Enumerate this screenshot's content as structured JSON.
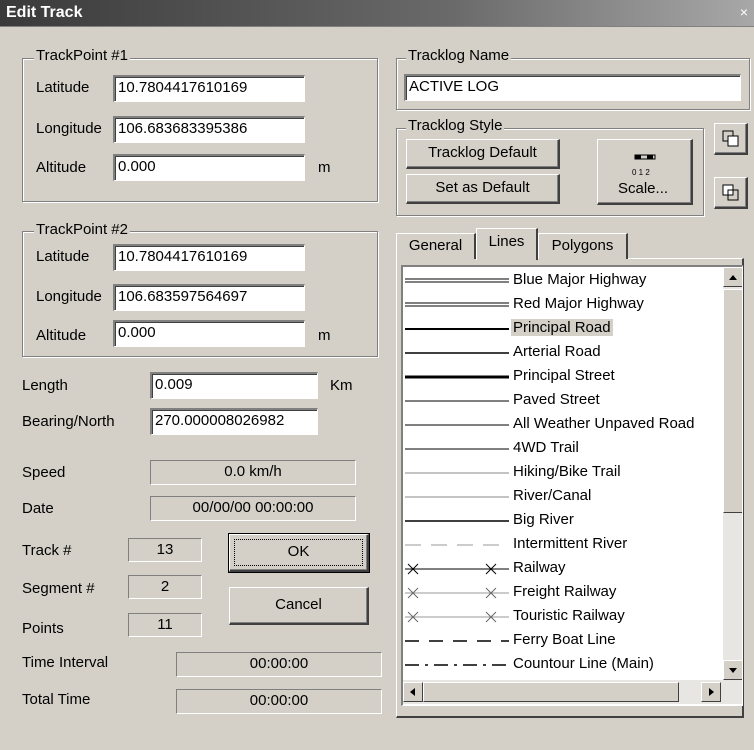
{
  "window": {
    "title": "Edit Track",
    "close_glyph": "×"
  },
  "trackpoint1": {
    "legend": "TrackPoint #1",
    "latitude_label": "Latitude",
    "latitude": "10.7804417610169",
    "longitude_label": "Longitude",
    "longitude": "106.683683395386",
    "altitude_label": "Altitude",
    "altitude": "0.000",
    "unit": "m"
  },
  "trackpoint2": {
    "legend": "TrackPoint #2",
    "latitude_label": "Latitude",
    "latitude": "10.7804417610169",
    "longitude_label": "Longitude",
    "longitude": "106.683597564697",
    "altitude_label": "Altitude",
    "altitude": "0.000",
    "unit": "m"
  },
  "stats": {
    "length_label": "Length",
    "length": "0.009",
    "length_unit": "Km",
    "bearing_label": "Bearing/North",
    "bearing": "270.000008026982",
    "speed_label": "Speed",
    "speed": "0.0 km/h",
    "date_label": "Date",
    "date": "00/00/00 00:00:00",
    "track_label": "Track #",
    "track": "13",
    "segment_label": "Segment #",
    "segment": "2",
    "points_label": "Points",
    "points": "11",
    "interval_label": "Time Interval",
    "interval": "00:00:00",
    "total_label": "Total Time",
    "total": "00:00:00"
  },
  "buttons": {
    "ok": "OK",
    "cancel": "Cancel"
  },
  "tracklog": {
    "name_legend": "Tracklog Name",
    "name": "ACTIVE LOG",
    "style_legend": "Tracklog Style",
    "tracklog_default": "Tracklog Default",
    "set_default": "Set as Default",
    "scale": "Scale...",
    "scale_icon_text": "0 1 2"
  },
  "tabs": {
    "general": "General",
    "lines": "Lines",
    "polygons": "Polygons",
    "active": "Lines"
  },
  "lines": [
    {
      "label": "Blue Major Highway",
      "style": "double",
      "selected": false
    },
    {
      "label": "Red Major Highway",
      "style": "double",
      "selected": false
    },
    {
      "label": "Principal Road",
      "style": "thick",
      "selected": true
    },
    {
      "label": "Arterial Road",
      "style": "medium",
      "selected": false
    },
    {
      "label": "Principal Street",
      "style": "bold",
      "selected": false
    },
    {
      "label": "Paved Street",
      "style": "thin",
      "selected": false
    },
    {
      "label": "All Weather Unpaved Road",
      "style": "thin",
      "selected": false
    },
    {
      "label": "4WD Trail",
      "style": "thin",
      "selected": false
    },
    {
      "label": "Hiking/Bike Trail",
      "style": "gray",
      "selected": false
    },
    {
      "label": "River/Canal",
      "style": "gray",
      "selected": false
    },
    {
      "label": "Big River",
      "style": "medium",
      "selected": false
    },
    {
      "label": "Intermittent River",
      "style": "dashgray",
      "selected": false
    },
    {
      "label": "Railway",
      "style": "railway",
      "selected": false
    },
    {
      "label": "Freight Railway",
      "style": "railgray",
      "selected": false
    },
    {
      "label": "Touristic Railway",
      "style": "railgray",
      "selected": false
    },
    {
      "label": "Ferry Boat Line",
      "style": "dash",
      "selected": false
    },
    {
      "label": "Countour Line (Main)",
      "style": "dashdot",
      "selected": false
    }
  ]
}
